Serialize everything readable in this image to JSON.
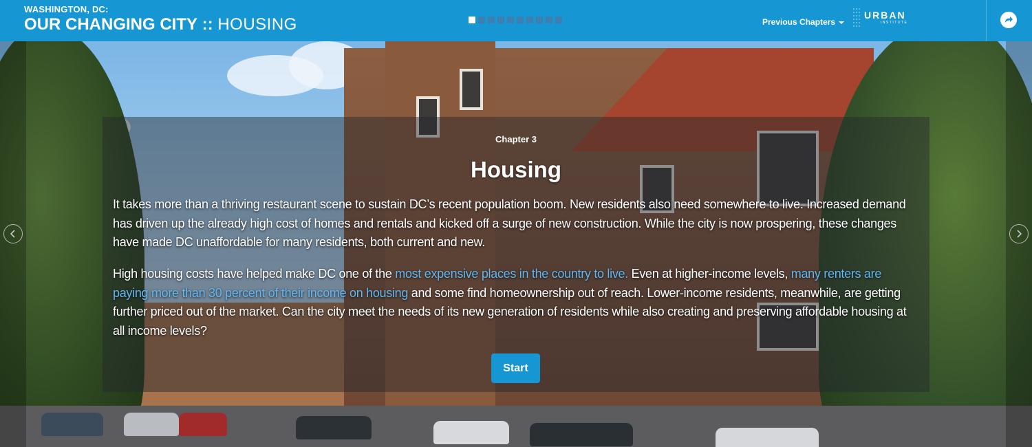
{
  "header": {
    "subtitle": "WASHINGTON, DC:",
    "title": "OUR CHANGING CITY",
    "separator": "::",
    "chapter_name": "HOUSING",
    "progress": {
      "total_dots": 10,
      "active_index": 0
    },
    "previous_chapters_label": "Previous Chapters",
    "logo_text": "URBAN",
    "logo_subtext": "INSTITUTE",
    "share_icon": "share-arrow-icon"
  },
  "intro": {
    "chapter_label": "Chapter 3",
    "title": "Housing",
    "paragraph1": "It takes more than a thriving restaurant scene to sustain DC’s recent population boom. New residents also need somewhere to live. Increased demand has driven up the already high cost of homes and rentals and kicked off a surge of new construction. While the city is now prospering, these changes have made DC unaffordable for many residents, both current and new.",
    "paragraph2_part1": "High housing costs have helped make DC one of the ",
    "paragraph2_link1": "most expensive places in the country to live.",
    "paragraph2_part2": " Even at higher-income levels, ",
    "paragraph2_link2": "many renters are paying more than 30 percent of their income on housing",
    "paragraph2_part3": " and some find homeownership out of reach. Lower-income residents, meanwhile, are getting further priced out of the market. Can the city meet the needs of its new generation of residents while also creating and preserving affordable housing at all income levels?",
    "start_label": "Start"
  },
  "navigation": {
    "prev_icon": "chevron-left-icon",
    "next_icon": "chevron-right-icon"
  },
  "colors": {
    "brand_blue": "#1696d2",
    "link_blue": "#64b7f0",
    "overlay": "rgba(35,38,44,0.45)"
  }
}
